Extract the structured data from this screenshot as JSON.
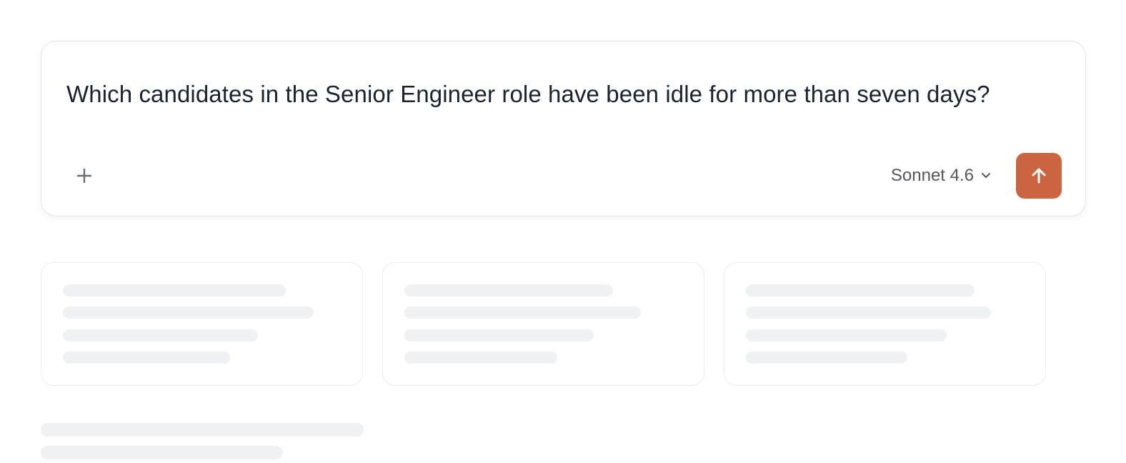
{
  "composer": {
    "prompt": "Which candidates in the Senior Engineer role have been idle for more than seven days?",
    "model_label": "Sonnet 4.6",
    "attach_icon": "plus-icon",
    "model_dropdown_icon": "chevron-down-icon",
    "send_icon": "arrow-up-icon",
    "accent_color": "#cb6441"
  },
  "suggestions": {
    "state": "loading",
    "card_count": 3
  }
}
